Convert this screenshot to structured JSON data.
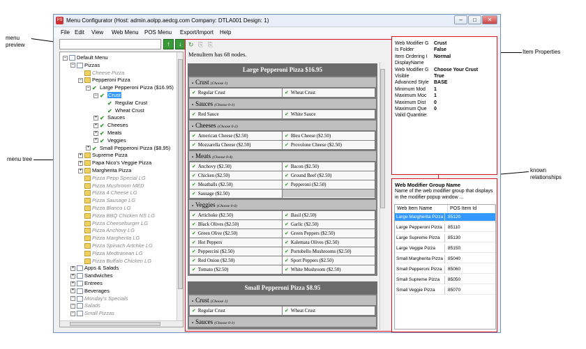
{
  "annotations": {
    "menu_preview": "menu\npreview",
    "menu_tree": "menu tree",
    "item_properties": "Item Properties",
    "known_relationships": "known\nrelationships"
  },
  "window": {
    "title": "Menu Configurator (Host: admin.aolpp.aedcg.com  Company: DTLA001  Design: 1)",
    "icon_text": "PS",
    "buttons": {
      "minimize": "–",
      "maximize": "□",
      "close": "✕"
    }
  },
  "menubar": [
    "File",
    "Edit",
    "View",
    "Web Menu",
    "POS Menu",
    "Export/Import",
    "Help"
  ],
  "tree": {
    "search_value": "",
    "up_label": "↑",
    "down_label": "↓",
    "nodes": [
      {
        "label": "Default Menu",
        "indent": 0,
        "exp": "–",
        "icon": "doc",
        "grey": false
      },
      {
        "label": "Pizzas",
        "indent": 1,
        "exp": "–",
        "icon": "doc",
        "grey": false
      },
      {
        "label": "Cheese Pizza",
        "indent": 2,
        "exp": "",
        "icon": "folder",
        "grey": true
      },
      {
        "label": "Pepperoni Pizza",
        "indent": 2,
        "exp": "–",
        "icon": "folder",
        "grey": false
      },
      {
        "label": "Large Pepperoni Pizza ($16.95)",
        "indent": 3,
        "exp": "–",
        "icon": "check",
        "grey": false
      },
      {
        "label": "Crust",
        "indent": 4,
        "exp": "–",
        "icon": "check",
        "grey": false,
        "selected": true
      },
      {
        "label": "Regular Crust",
        "indent": 5,
        "exp": "",
        "icon": "check",
        "grey": false
      },
      {
        "label": "Wheat Crust",
        "indent": 5,
        "exp": "",
        "icon": "check",
        "grey": false
      },
      {
        "label": "Sauces",
        "indent": 4,
        "exp": "+",
        "icon": "check",
        "grey": false
      },
      {
        "label": "Cheeses",
        "indent": 4,
        "exp": "+",
        "icon": "check",
        "grey": false
      },
      {
        "label": "Meats",
        "indent": 4,
        "exp": "+",
        "icon": "check",
        "grey": false
      },
      {
        "label": "Veggies",
        "indent": 4,
        "exp": "+",
        "icon": "check",
        "grey": false
      },
      {
        "label": "Small Pepperoni Pizza ($8.95)",
        "indent": 3,
        "exp": "+",
        "icon": "check",
        "grey": false
      },
      {
        "label": "Supreme Pizza",
        "indent": 2,
        "exp": "+",
        "icon": "folder",
        "grey": false
      },
      {
        "label": "Papa Nico's Veggie Pizza",
        "indent": 2,
        "exp": "+",
        "icon": "folder",
        "grey": false
      },
      {
        "label": "Margherita Pizza",
        "indent": 2,
        "exp": "+",
        "icon": "folder",
        "grey": false
      },
      {
        "label": "Pizza Pepp Special LG",
        "indent": 2,
        "exp": "",
        "icon": "folder",
        "grey": true
      },
      {
        "label": "Pizza Mushroom MED",
        "indent": 2,
        "exp": "",
        "icon": "folder",
        "grey": true
      },
      {
        "label": "Pizza 4 Cheese LG",
        "indent": 2,
        "exp": "",
        "icon": "folder",
        "grey": true
      },
      {
        "label": "Pizza Sausage LG",
        "indent": 2,
        "exp": "",
        "icon": "folder",
        "grey": true
      },
      {
        "label": "Pizza Blanco LG",
        "indent": 2,
        "exp": "",
        "icon": "folder",
        "grey": true
      },
      {
        "label": "Pizza BBQ Chicken NS LG",
        "indent": 2,
        "exp": "",
        "icon": "folder",
        "grey": true
      },
      {
        "label": "Pizza Cheeseburger LG",
        "indent": 2,
        "exp": "",
        "icon": "folder",
        "grey": true
      },
      {
        "label": "Pizza Anchovy LG",
        "indent": 2,
        "exp": "",
        "icon": "folder",
        "grey": true
      },
      {
        "label": "Pizza Margherita LG",
        "indent": 2,
        "exp": "",
        "icon": "folder",
        "grey": true
      },
      {
        "label": "Pizza Spinach Artchke LG",
        "indent": 2,
        "exp": "",
        "icon": "folder",
        "grey": true
      },
      {
        "label": "Pizza Medtranean LG",
        "indent": 2,
        "exp": "",
        "icon": "folder",
        "grey": true
      },
      {
        "label": "Pizza Buffalo Chicken LG",
        "indent": 2,
        "exp": "",
        "icon": "folder",
        "grey": true
      },
      {
        "label": "Apps & Salads",
        "indent": 1,
        "exp": "+",
        "icon": "doc",
        "grey": false
      },
      {
        "label": "Sandwiches",
        "indent": 1,
        "exp": "+",
        "icon": "doc",
        "grey": false
      },
      {
        "label": "Entrees",
        "indent": 1,
        "exp": "+",
        "icon": "doc",
        "grey": false
      },
      {
        "label": "Beverages",
        "indent": 1,
        "exp": "+",
        "icon": "doc",
        "grey": false
      },
      {
        "label": "Monday's Specials",
        "indent": 1,
        "exp": "+",
        "icon": "doc",
        "grey": true
      },
      {
        "label": "Salads",
        "indent": 1,
        "exp": "+",
        "icon": "doc",
        "grey": true
      },
      {
        "label": "Small Pizzas",
        "indent": 1,
        "exp": "+",
        "icon": "doc",
        "grey": true
      }
    ]
  },
  "preview": {
    "toolbar_icons": [
      "refresh-icon",
      "copy-icon",
      "paste-icon"
    ],
    "note": "MenuItem has 68 nodes.",
    "items": [
      {
        "title": "Large Pepperoni Pizza $16.95",
        "groups": [
          {
            "name": "Crust",
            "sub": "(Choose 1)",
            "options": [
              "Regular Crust",
              "Wheat Crust"
            ]
          },
          {
            "name": "Sauces",
            "sub": "(Choose 0-1)",
            "options": [
              "Red Sauce",
              "White Sauce"
            ]
          },
          {
            "name": "Cheeses",
            "sub": "(Choose 0-2)",
            "options": [
              "American Cheese ($2.50)",
              "Bleu Cheese ($2.50)",
              "Mozzarella Cheese ($2.50)",
              "Provolone Cheese ($2.50)"
            ]
          },
          {
            "name": "Meats",
            "sub": "(Choose 0-4)",
            "options": [
              "Anchovy ($2.50)",
              "Bacon ($2.50)",
              "Chicken ($2.50)",
              "Ground Beef ($2.50)",
              "Meatballs ($2.50)",
              "Pepperoni ($2.50)",
              "Sausage ($2.50)"
            ]
          },
          {
            "name": "Veggies",
            "sub": "(Choose 0-4)",
            "options": [
              "Artichoke ($2.50)",
              "Basil ($2.50)",
              "Black Olives ($2.50)",
              "Garlic ($2.50)",
              "Green Olive ($2.50)",
              "Green Peppers ($2.50)",
              "Hot Peppers",
              "Kalemata Olives ($2.50)",
              "Peppercini ($2.50)",
              "Portobello Mushrooms ($2.50)",
              "Red Onion ($2.50)",
              "Sport Peppers ($2.50)",
              "Tomato ($2.50)",
              "White Mushroom ($2.50)"
            ]
          }
        ]
      },
      {
        "title": "Small Pepperoni Pizza $8.95",
        "groups": [
          {
            "name": "Crust",
            "sub": "(Choose 1)",
            "options": [
              "Regular Crust",
              "Wheat Crust"
            ]
          },
          {
            "name": "Sauces",
            "sub": "(Choose 0-1)",
            "options": []
          }
        ]
      }
    ]
  },
  "properties": [
    {
      "k": "Web Modifier G",
      "v": "Crust"
    },
    {
      "k": "Is Folder",
      "v": "False"
    },
    {
      "k": "Item Ordering I",
      "v": "Normal"
    },
    {
      "k": "DisplayName",
      "v": ""
    },
    {
      "k": "Web Modifier G",
      "v": "Choose Your Crust"
    },
    {
      "k": "Visible",
      "v": "True"
    },
    {
      "k": "Advanced Style",
      "v": "BASE"
    },
    {
      "k": "Minimum Mod",
      "v": "1"
    },
    {
      "k": "Maximum Moc",
      "v": "1"
    },
    {
      "k": "Maximum Dist",
      "v": "0"
    },
    {
      "k": "Maximum Que",
      "v": "0"
    },
    {
      "k": "Valid Quantitie:",
      "v": ""
    }
  ],
  "relationships": {
    "title": "Web Modifier Group Name",
    "description": "Name of the web modifier group that displays in the modifier popup window ...",
    "columns": [
      "Web Item Name",
      "POS Item Id"
    ],
    "rows": [
      [
        "Large Margherita Pizza",
        "85120"
      ],
      [
        "Large Pepperoni Pizza",
        "85110"
      ],
      [
        "Large Supreme Pizza",
        "85130"
      ],
      [
        "Large Veggie Pizza",
        "85150"
      ],
      [
        "Small Margherita Pizza",
        "85040"
      ],
      [
        "Small Pepperoni Pizza",
        "85060"
      ],
      [
        "Small Supreme Pizza",
        "85050"
      ],
      [
        "Small Veggie Pizza",
        "85070"
      ]
    ],
    "selected_row": 0
  }
}
